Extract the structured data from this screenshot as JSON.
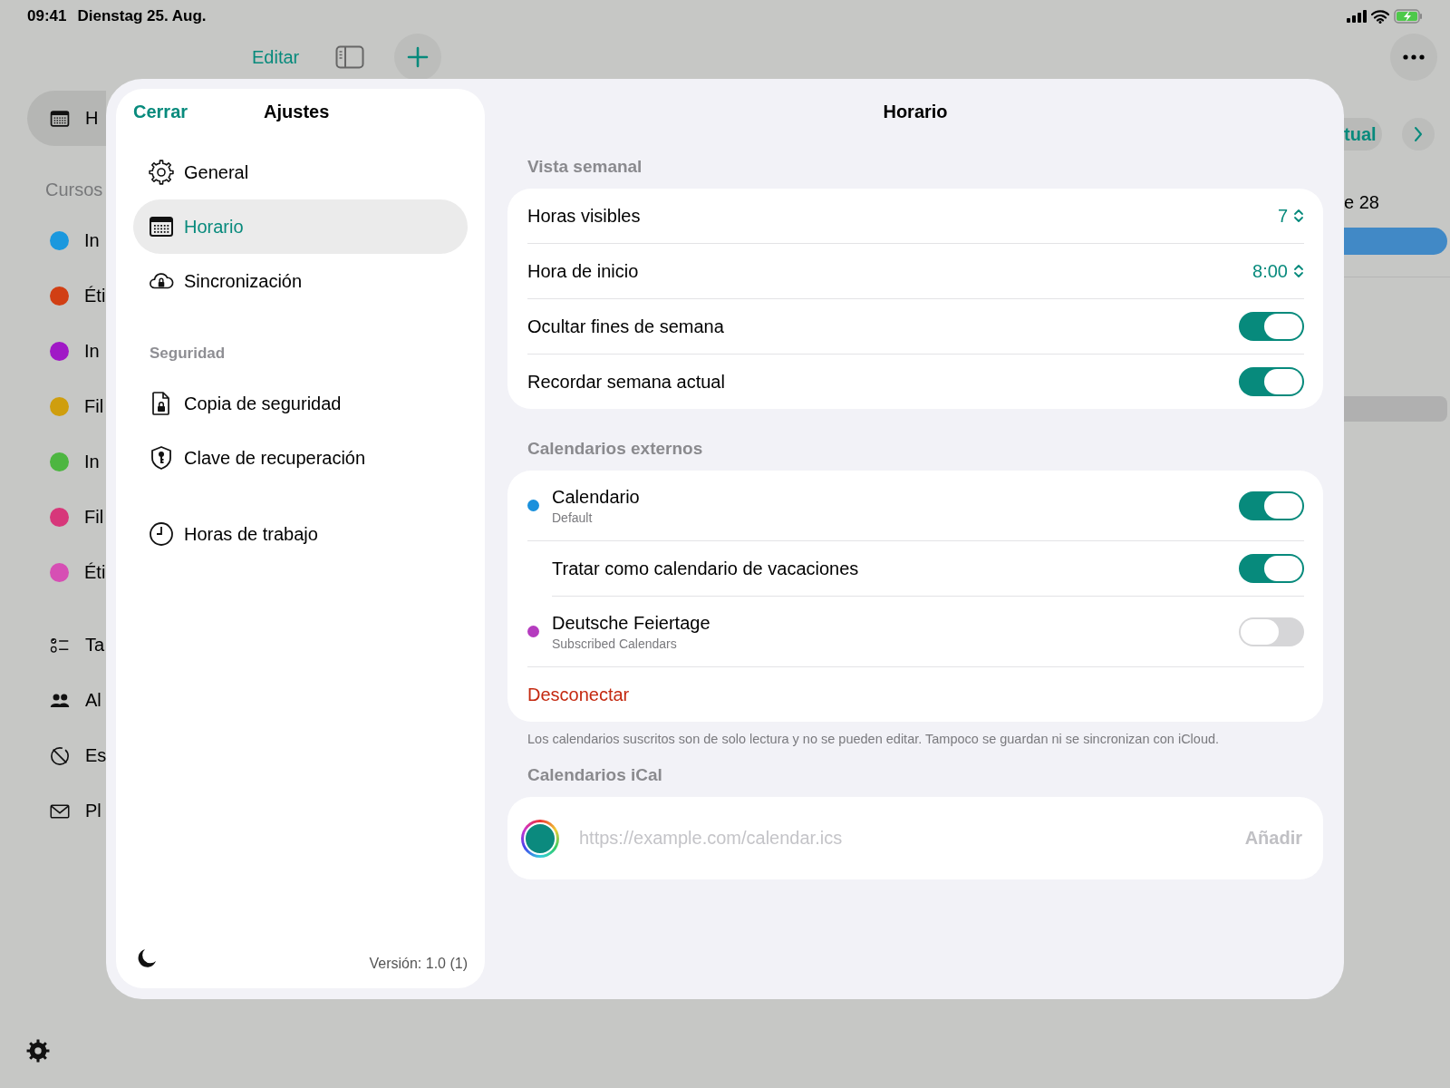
{
  "status_bar": {
    "time": "09:41",
    "date": "Dienstag 25. Aug."
  },
  "toolbar": {
    "edit": "Editar"
  },
  "background_sidebar": {
    "current": {
      "label": "H",
      "selected": true
    },
    "section": "Cursos",
    "courses": [
      {
        "label": "In",
        "color": "#1b98de"
      },
      {
        "label": "Éti",
        "color": "#d13f14"
      },
      {
        "label": "In",
        "color": "#a019c6"
      },
      {
        "label": "Fil",
        "color": "#cf9e0e"
      },
      {
        "label": "In",
        "color": "#4db641"
      },
      {
        "label": "Fil",
        "color": "#d7377a"
      },
      {
        "label": "Éti",
        "color": "#d64fb4"
      }
    ],
    "items": [
      {
        "kind": "tasks",
        "label": "Ta"
      },
      {
        "kind": "people",
        "label": "Al"
      },
      {
        "kind": "blocked",
        "label": "Es"
      },
      {
        "kind": "mail",
        "label": "Pl"
      }
    ]
  },
  "background_main": {
    "week_button": "tual",
    "date": "e 28"
  },
  "settings": {
    "close": "Cerrar",
    "title": "Ajustes",
    "groups": [
      {
        "items": [
          {
            "kind": "gear",
            "label": "General",
            "selected": false
          },
          {
            "kind": "calendar",
            "label": "Horario",
            "selected": true
          },
          {
            "kind": "cloud-lock",
            "label": "Sincronización",
            "selected": false
          }
        ]
      },
      {
        "title": "Seguridad",
        "items": [
          {
            "kind": "doc-lock",
            "label": "Copia de seguridad",
            "selected": false
          },
          {
            "kind": "shield-key",
            "label": "Clave de recuperación",
            "selected": false
          }
        ]
      },
      {
        "items": [
          {
            "kind": "clock",
            "label": "Horas de trabajo",
            "selected": false
          }
        ]
      }
    ],
    "version": "Versión: 1.0 (1)"
  },
  "detail": {
    "title": "Horario",
    "sections": [
      {
        "title": "Vista semanal",
        "rows": [
          {
            "kind": "stepper",
            "label": "Horas visibles",
            "value": "7"
          },
          {
            "kind": "stepper",
            "label": "Hora de inicio",
            "value": "8:00"
          },
          {
            "kind": "toggle",
            "label": "Ocultar fines de semana",
            "on": true
          },
          {
            "kind": "toggle",
            "label": "Recordar semana actual",
            "on": true
          }
        ]
      },
      {
        "title": "Calendarios externos",
        "rows": [
          {
            "kind": "calendar",
            "label": "Calendario",
            "subtitle": "Default",
            "color": "#1a90dc",
            "on": true
          },
          {
            "kind": "sub-toggle",
            "label": "Tratar como calendario de vacaciones",
            "on": true
          },
          {
            "kind": "calendar",
            "label": "Deutsche Feiertage",
            "subtitle": "Subscribed Calendars",
            "color": "#b53cbf",
            "on": false
          },
          {
            "kind": "action",
            "label": "Desconectar"
          }
        ],
        "footer": "Los calendarios suscritos son de solo lectura y no se pueden editar. Tampoco se guardan ni se sincronizan con iCloud."
      },
      {
        "title": "Calendarios iCal",
        "rows": [
          {
            "kind": "url",
            "placeholder": "https://example.com/calendar.ics",
            "button": "Añadir",
            "disabled": true
          }
        ]
      }
    ]
  }
}
